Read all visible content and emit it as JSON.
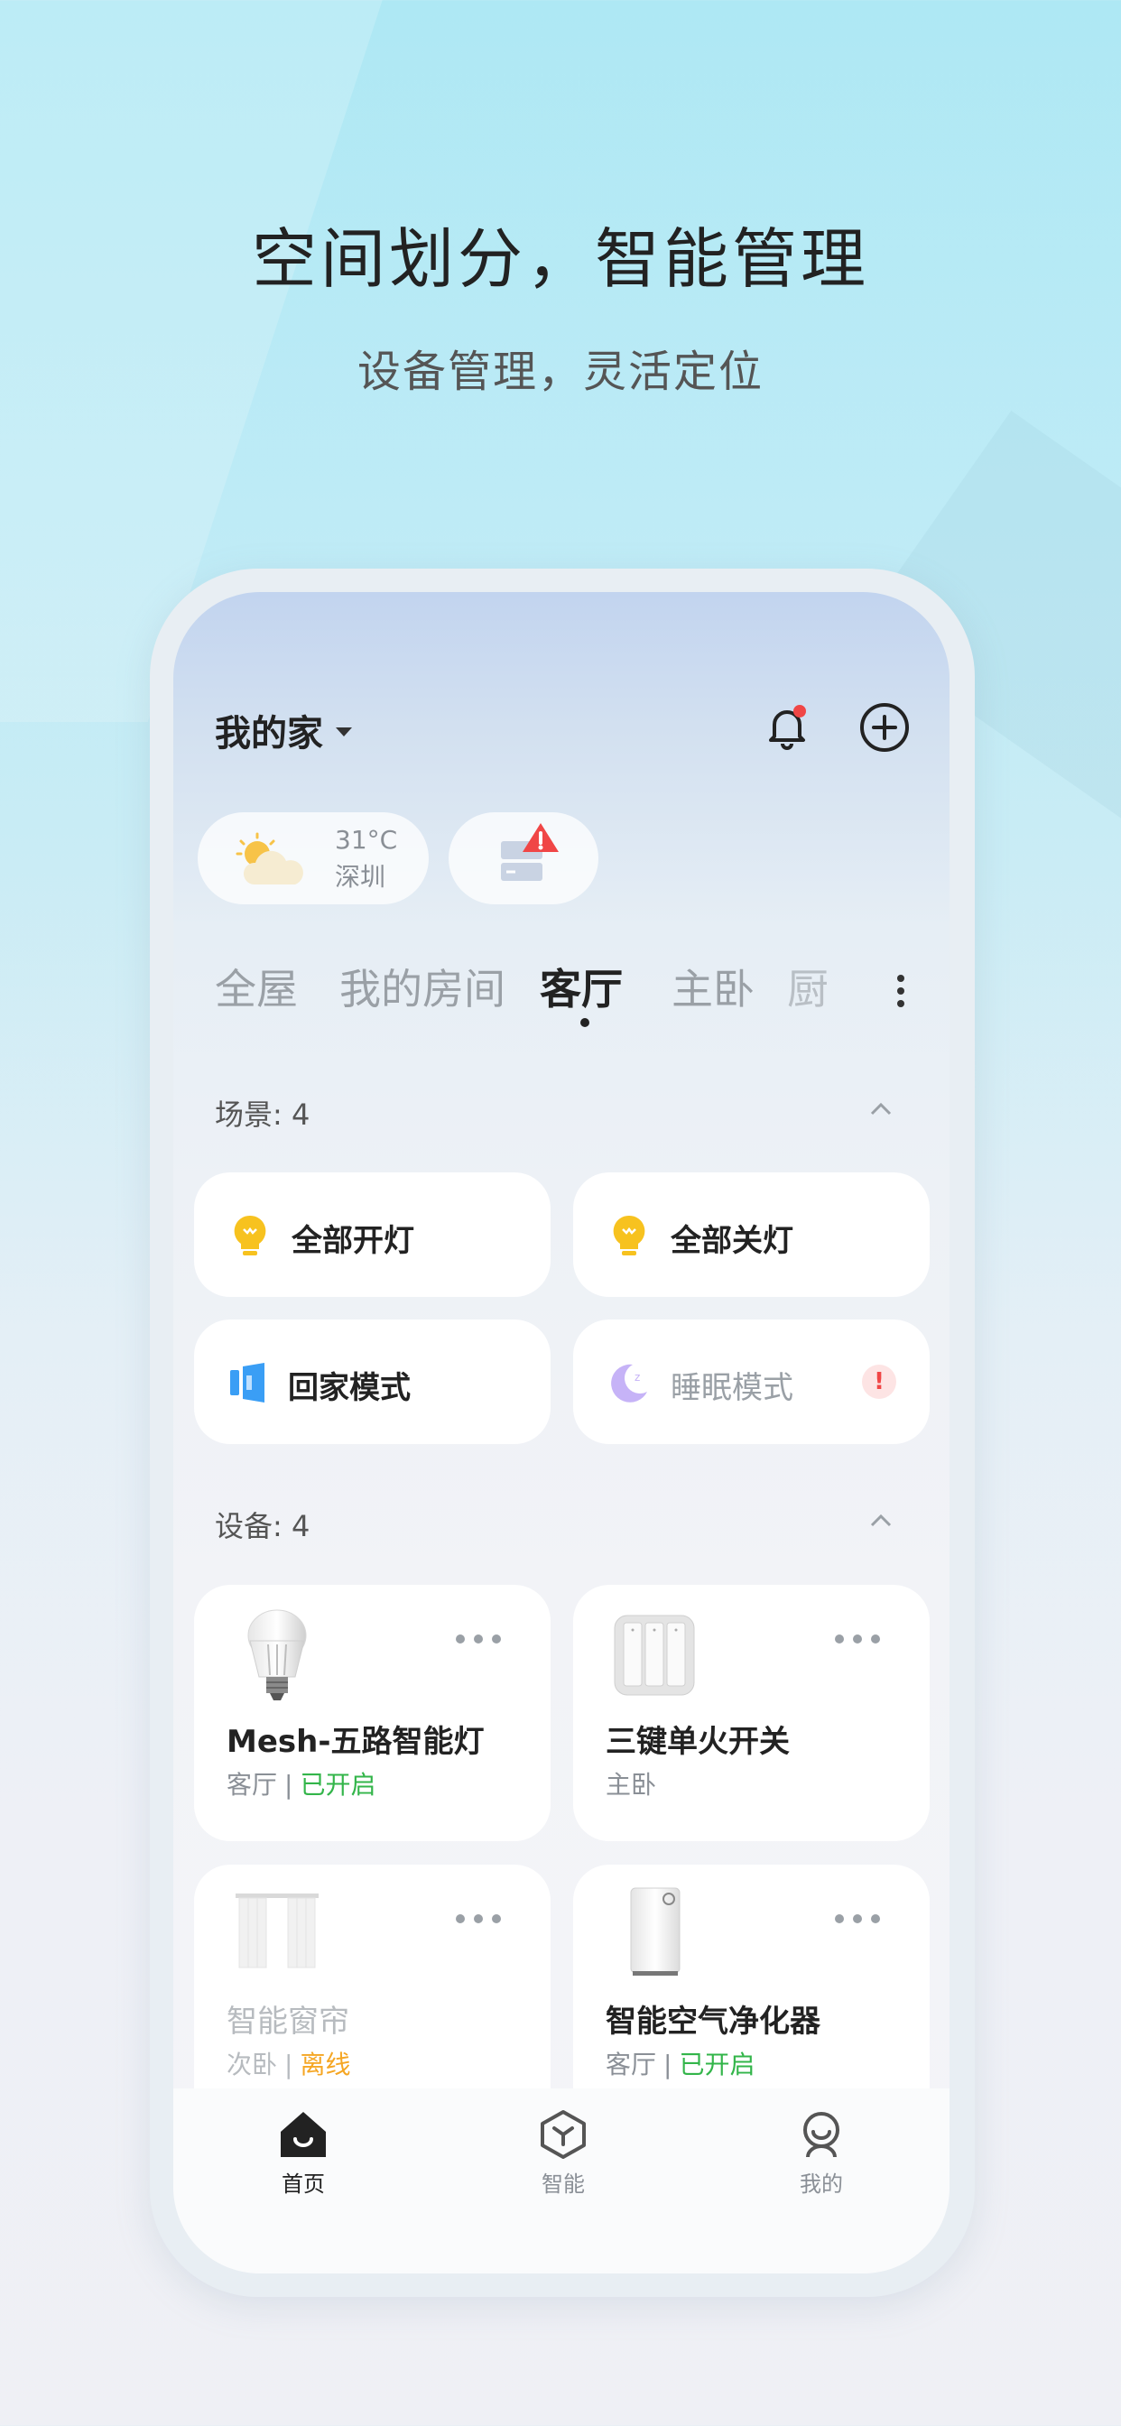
{
  "hero": {
    "title": "空间划分，智能管理",
    "subtitle": "设备管理，灵活定位"
  },
  "header": {
    "home_name": "我的家"
  },
  "weather": {
    "temperature": "31°C",
    "city": "深圳"
  },
  "tabs": [
    {
      "label": "全屋"
    },
    {
      "label": "我的房间"
    },
    {
      "label": "客厅",
      "active": true
    },
    {
      "label": "主卧"
    },
    {
      "label": "厨"
    }
  ],
  "scenes": {
    "label": "场景: 4",
    "items": [
      {
        "label": "全部开灯",
        "icon": "bulb-icon"
      },
      {
        "label": "全部关灯",
        "icon": "bulb-icon"
      },
      {
        "label": "回家模式",
        "icon": "door-icon"
      },
      {
        "label": "睡眠模式",
        "icon": "moon-icon",
        "alert": "!"
      }
    ]
  },
  "devices": {
    "label": "设备: 4",
    "items": [
      {
        "name": "Mesh-五路智能灯",
        "room": "客厅",
        "separator": "|",
        "status": "已开启",
        "status_color": "#33b54a"
      },
      {
        "name": "三键单火开关",
        "room": "主卧"
      },
      {
        "name": "智能窗帘",
        "room": "次卧",
        "separator": "|",
        "status": "离线",
        "status_color": "#f5a623"
      },
      {
        "name": "智能空气净化器",
        "room": "客厅",
        "separator": "|",
        "status": "已开启",
        "status_color": "#33b54a"
      }
    ]
  },
  "nav": [
    {
      "label": "首页",
      "icon": "home-icon",
      "active": true
    },
    {
      "label": "智能",
      "icon": "smart-hex-icon"
    },
    {
      "label": "我的",
      "icon": "profile-icon"
    }
  ],
  "colors": {
    "active_green": "#33b54a",
    "offline_orange": "#f5a623",
    "notification_red": "#f04646"
  }
}
